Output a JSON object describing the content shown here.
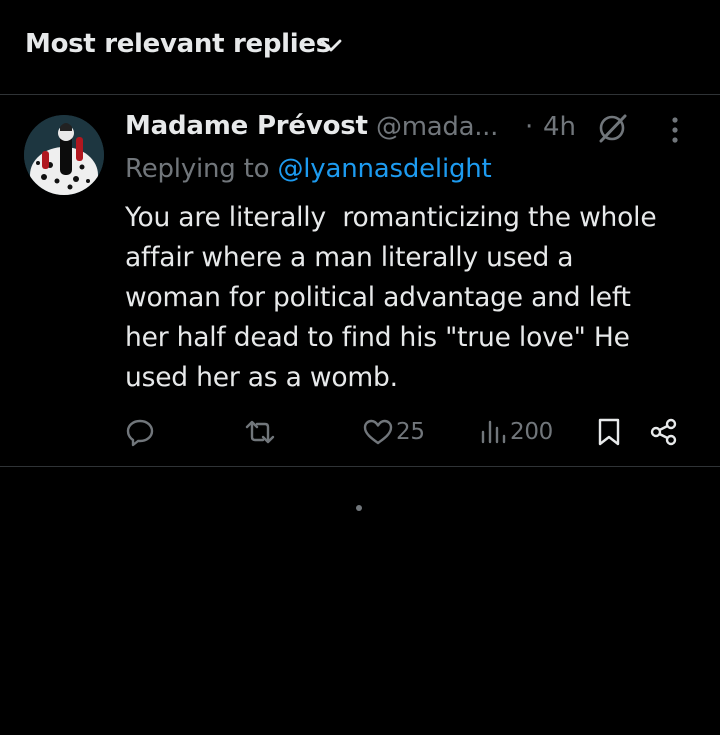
{
  "header": {
    "title": "Most relevant replies",
    "chevron_icon": "chevron-down-icon"
  },
  "tweet": {
    "display_name": "Madame Prévost",
    "handle": "@mada...",
    "separator": "·",
    "time": "4h",
    "replying_prefix": "Replying to ",
    "replying_handle": "@lyannasdelight",
    "text": "You are literally  romanticizing the whole\naffair where a man literally used a\nwoman for political advantage and left\nher half dead to find his \"true love\" He\nused her as a womb.",
    "actions": {
      "reply_count": "",
      "retweet_count": "",
      "like_count": "25",
      "view_count": "200"
    }
  },
  "colors": {
    "background": "#000000",
    "primary_text": "#e7e9ea",
    "secondary_text": "#71767b",
    "link": "#1d9bf0",
    "divider": "#2f3336"
  },
  "icons": [
    "chevron-down-icon",
    "grok-icon",
    "more-icon",
    "reply-icon",
    "retweet-icon",
    "like-icon",
    "views-icon",
    "bookmark-icon",
    "share-icon"
  ]
}
